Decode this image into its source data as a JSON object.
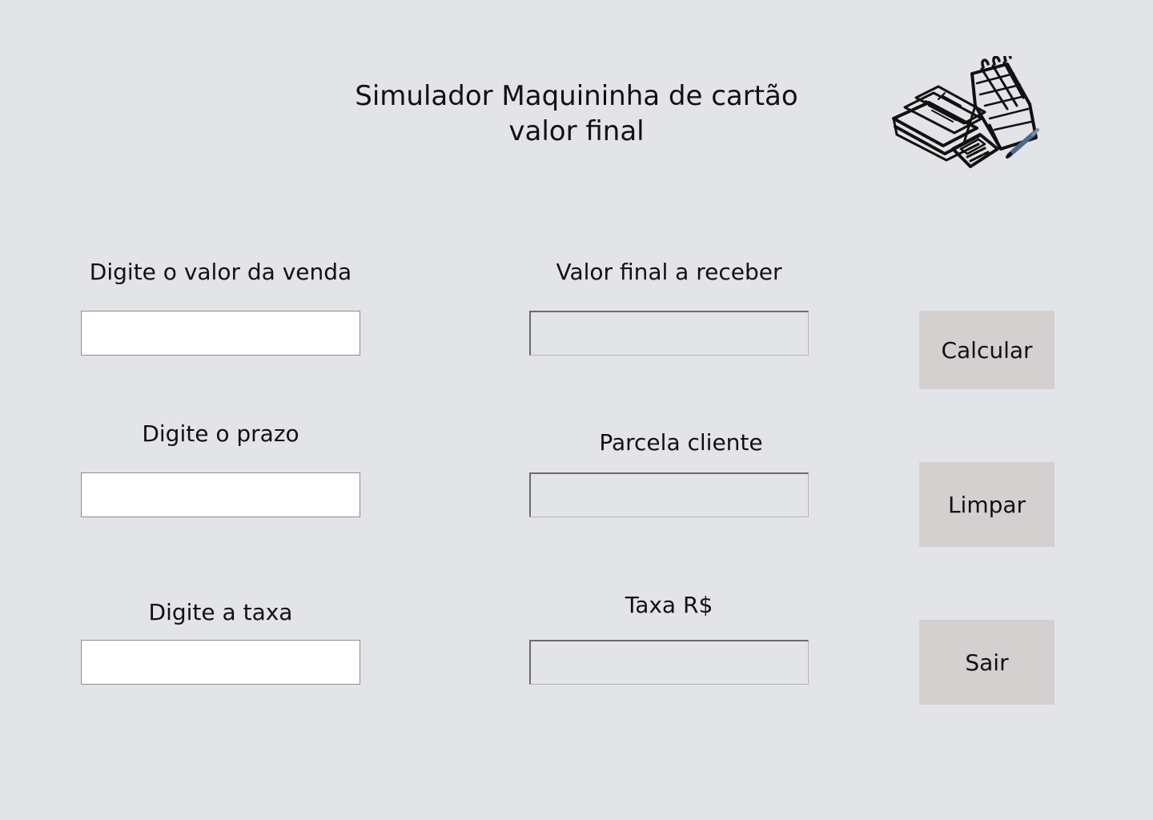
{
  "header": {
    "title_line1": "Simulador Maquininha de cartão",
    "title_line2": "valor final",
    "logo_icon": "accounting-documents-calendar-calculator-pen"
  },
  "inputs": {
    "valor_venda": {
      "label": "Digite o valor da venda",
      "value": ""
    },
    "prazo": {
      "label": "Digite o prazo",
      "value": ""
    },
    "taxa": {
      "label": "Digite a taxa",
      "value": ""
    }
  },
  "outputs": {
    "valor_final": {
      "label": "Valor final a receber",
      "value": ""
    },
    "parcela_cliente": {
      "label": "Parcela cliente",
      "value": ""
    },
    "taxa_rs": {
      "label": "Taxa R$",
      "value": ""
    }
  },
  "buttons": {
    "calcular": "Calcular",
    "limpar": "Limpar",
    "sair": "Sair"
  },
  "colors": {
    "background": "#e3e4e8",
    "button": "#d3d0cf",
    "input_editable": "#ffffff"
  }
}
